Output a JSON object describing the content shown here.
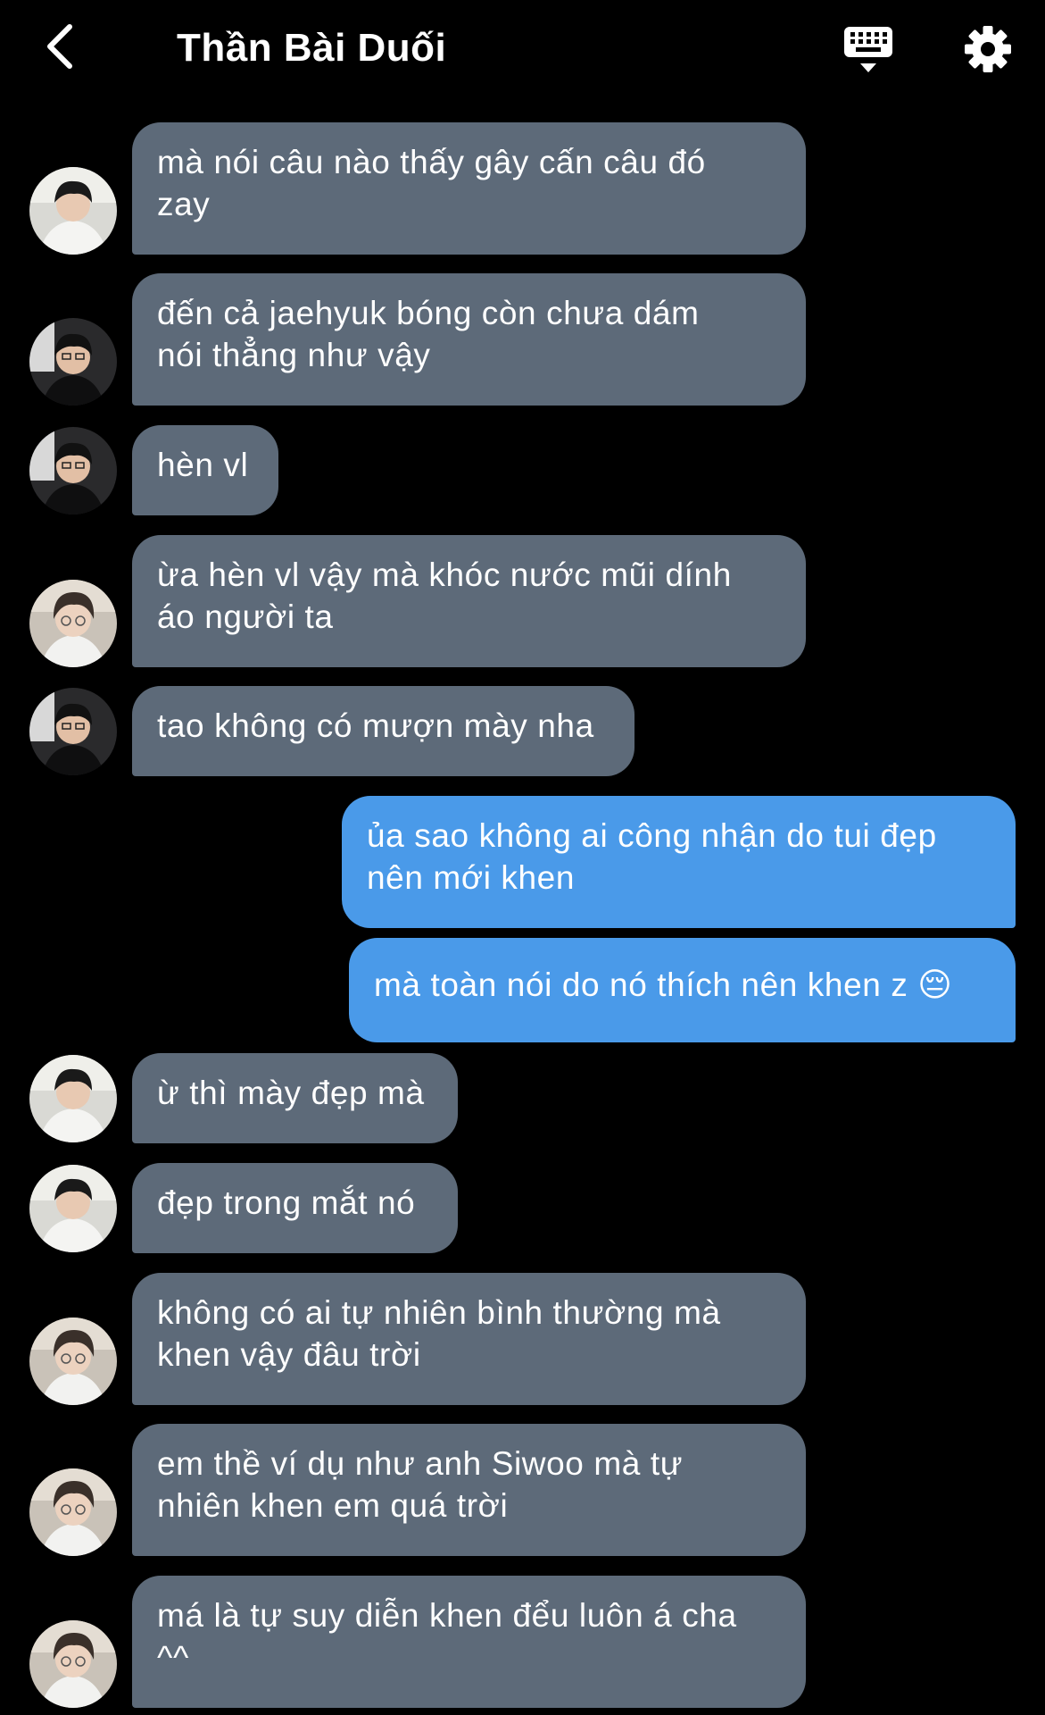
{
  "header": {
    "title": "Thần Bài Duối",
    "back_icon": "chevron-left-icon",
    "keyboard_icon": "keyboard-icon",
    "settings_icon": "gear-icon"
  },
  "colors": {
    "background": "#000000",
    "incoming_bubble": "#5d6a79",
    "outgoing_bubble": "#4a9ae9",
    "text": "#ffffff"
  },
  "messages": [
    {
      "direction": "incoming",
      "sender_avatar": "avatar-a",
      "text": "mà nói câu nào thấy gây cấn câu đó\nzay"
    },
    {
      "direction": "incoming",
      "sender_avatar": "avatar-b",
      "text": "đến cả jaehyuk bóng còn chưa dám\nnói thẳng như vậy"
    },
    {
      "direction": "incoming",
      "sender_avatar": "avatar-b",
      "text": "hèn vl"
    },
    {
      "direction": "incoming",
      "sender_avatar": "avatar-c",
      "text": "ừa hèn vl vậy mà khóc nước mũi dính\náo người ta"
    },
    {
      "direction": "incoming",
      "sender_avatar": "avatar-b",
      "text": "tao không có mượn mày nha"
    },
    {
      "direction": "outgoing",
      "text": "ủa sao không ai công nhận do tui đẹp\nnên mới khen"
    },
    {
      "direction": "outgoing",
      "text": "mà toàn nói do nó thích nên khen z 😔"
    },
    {
      "direction": "incoming",
      "sender_avatar": "avatar-a",
      "text": "ừ thì mày đẹp mà"
    },
    {
      "direction": "incoming",
      "sender_avatar": "avatar-a",
      "text": "đẹp trong mắt nó"
    },
    {
      "direction": "incoming",
      "sender_avatar": "avatar-c",
      "text": "không có ai tự nhiên bình thường mà\nkhen vậy đâu trời"
    },
    {
      "direction": "incoming",
      "sender_avatar": "avatar-c",
      "text": "em thề ví dụ như anh Siwoo mà tự\nnhiên khen em quá trời"
    },
    {
      "direction": "incoming",
      "sender_avatar": "avatar-c",
      "text": "má là tự suy diễn khen đểu luôn á cha\n^^"
    }
  ]
}
